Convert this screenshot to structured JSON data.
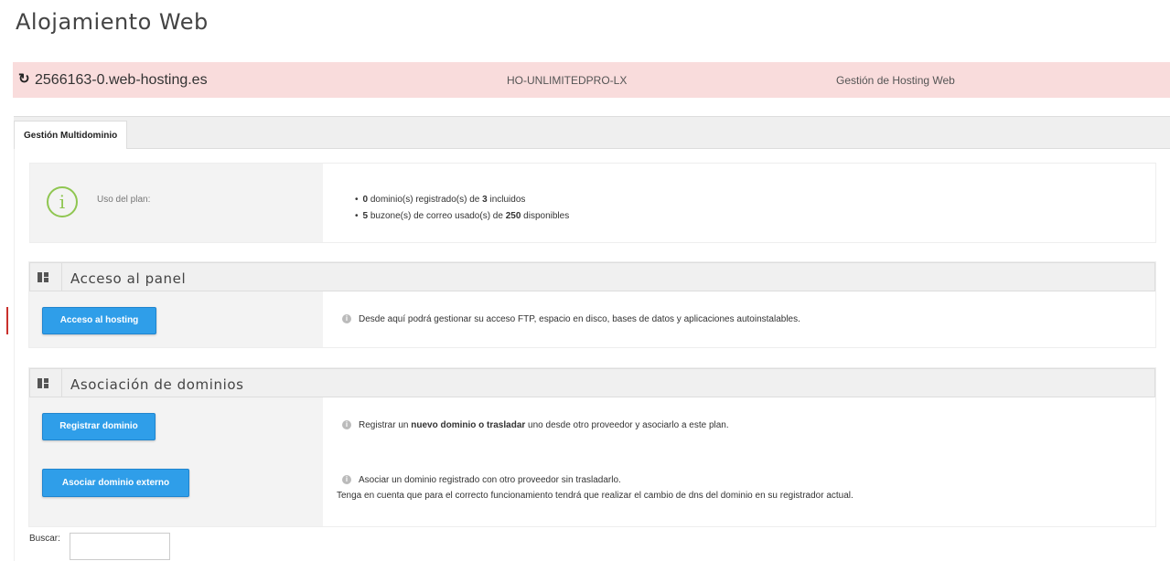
{
  "page": {
    "title": "Alojamiento Web"
  },
  "domain_bar": {
    "refresh_icon": "refresh-icon",
    "domain": "2566163-0.web-hosting.es",
    "plan_code": "HO-UNLIMITEDPRO-LX",
    "management_link": "Gestión de Hosting Web",
    "background_color": "#f9dcdc"
  },
  "tabs": [
    {
      "label": "Gestión Multidominio",
      "active": true
    }
  ],
  "plan_usage": {
    "icon": "info-icon",
    "label": "Uso del plan:",
    "domains": {
      "used": "0",
      "middle": " dominio(s) registrado(s) de ",
      "total": "3",
      "suffix": " incluidos"
    },
    "mailboxes": {
      "used": "5",
      "middle": " buzone(s) de correo usado(s) de ",
      "total": "250",
      "suffix": " disponibles"
    }
  },
  "panel_access": {
    "title": "Acceso al panel",
    "icon": "dashboard-icon",
    "button": "Acceso al hosting",
    "description": "Desde aquí podrá gestionar su acceso FTP, espacio en disco, bases de datos y aplicaciones autoinstalables."
  },
  "panel_domains": {
    "title": "Asociación de dominios",
    "icon": "dashboard-icon",
    "register": {
      "button": "Registrar dominio",
      "desc_a": "Registrar un ",
      "desc_b": "nuevo dominio o trasladar",
      "desc_c": " uno desde otro proveedor y asociarlo a este plan."
    },
    "external": {
      "button": "Asociar dominio externo",
      "desc_line1": "Asociar un dominio registrado con otro proveedor sin trasladarlo.",
      "desc_line2": "Tenga en cuenta que para el correcto funcionamiento tendrá que realizar el cambio de dns del dominio en su registrador actual."
    }
  },
  "search": {
    "label": "Buscar:",
    "value": ""
  },
  "colors": {
    "button": "#2f9ee9",
    "info_icon": "#8fc651",
    "tab_strip": "#efefef"
  }
}
